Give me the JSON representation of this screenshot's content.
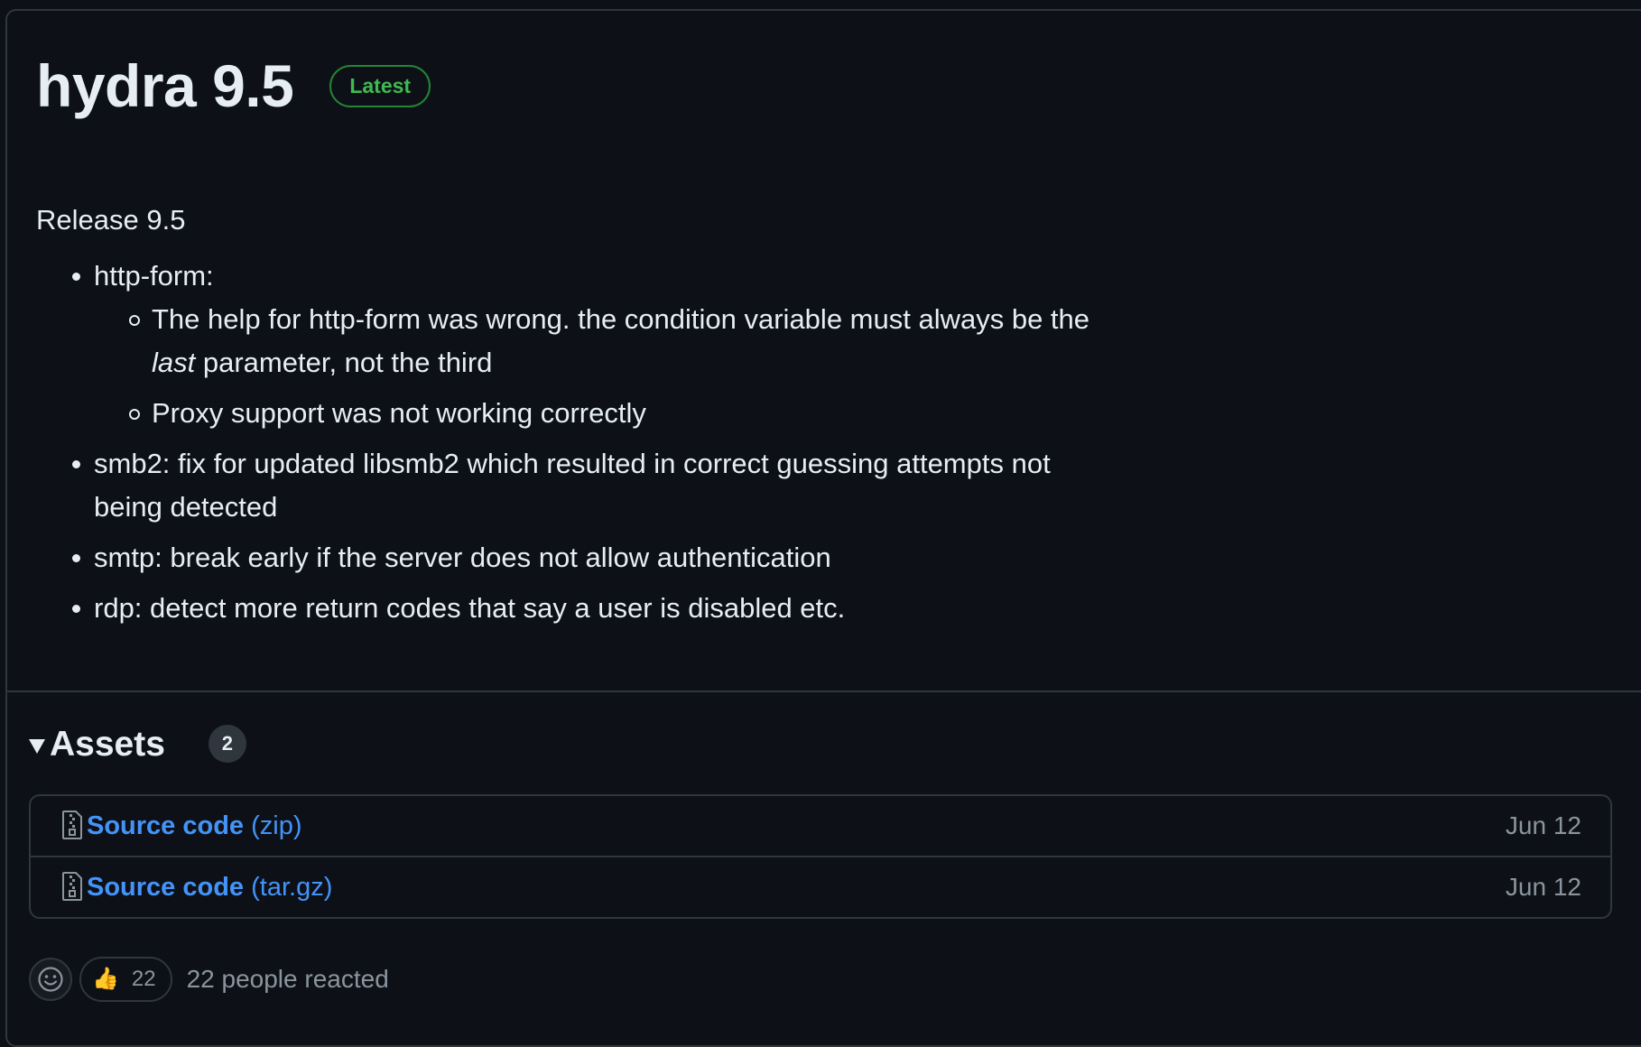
{
  "release": {
    "title": "hydra 9.5",
    "badge": "Latest",
    "notes_heading": "Release 9.5",
    "http_form_label": "http-form:",
    "http_form_sub1_pre": "The help for http-form was wrong. the condition variable must always be the ",
    "http_form_sub1_em": "last",
    "http_form_sub1_post": " parameter, not the third",
    "http_form_sub2": "Proxy support was not working correctly",
    "smb2": "smb2: fix for updated libsmb2 which resulted in correct guessing attempts not being detected",
    "smtp": "smtp: break early if the server does not allow authentication",
    "rdp": "rdp: detect more return codes that say a user is disabled etc."
  },
  "assets": {
    "title": "Assets",
    "count": "2",
    "items": [
      {
        "name": "Source code",
        "ext": "(zip)",
        "date": "Jun 12",
        "icon": "file-zip-icon"
      },
      {
        "name": "Source code",
        "ext": "(tar.gz)",
        "date": "Jun 12",
        "icon": "file-zip-icon"
      }
    ]
  },
  "reactions": {
    "emoji": "👍",
    "count": "22",
    "summary": "22 people reacted"
  },
  "colors": {
    "background": "#0d1117",
    "border": "#30363d",
    "text": "#e6edf3",
    "muted": "#8b949e",
    "link": "#4493f8",
    "latest_green": "#3fb950"
  }
}
